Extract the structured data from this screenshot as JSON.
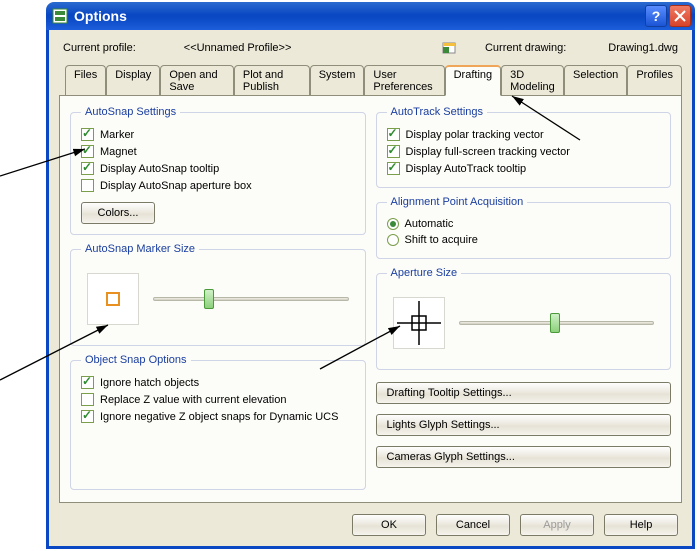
{
  "window": {
    "title": "Options"
  },
  "profile": {
    "label": "Current profile:",
    "value": "<<Unnamed Profile>>",
    "drawing_label": "Current drawing:",
    "drawing_value": "Drawing1.dwg"
  },
  "tabs": {
    "files": "Files",
    "display": "Display",
    "open_save": "Open and Save",
    "plot_publish": "Plot and Publish",
    "system": "System",
    "user_prefs": "User Preferences",
    "drafting": "Drafting",
    "modeling": "3D Modeling",
    "selection": "Selection",
    "profiles": "Profiles"
  },
  "groups": {
    "autosnap": {
      "legend": "AutoSnap Settings",
      "marker": "Marker",
      "magnet": "Magnet",
      "tooltip": "Display AutoSnap tooltip",
      "aperture": "Display AutoSnap aperture box",
      "colors_btn": "Colors..."
    },
    "autotrack": {
      "legend": "AutoTrack Settings",
      "polar": "Display polar tracking vector",
      "fullscreen": "Display full-screen tracking vector",
      "tooltip": "Display AutoTrack tooltip"
    },
    "alignment": {
      "legend": "Alignment Point Acquisition",
      "automatic": "Automatic",
      "shift": "Shift to acquire"
    },
    "marker_size": {
      "legend": "AutoSnap Marker Size"
    },
    "aperture_size": {
      "legend": "Aperture Size"
    },
    "osnap": {
      "legend": "Object Snap Options",
      "ignore_hatch": "Ignore hatch objects",
      "replace_z": "Replace Z value with current elevation",
      "ignore_neg_z": "Ignore negative Z object snaps for Dynamic UCS"
    },
    "drafting_tooltip_btn": "Drafting Tooltip Settings...",
    "lights_glyph_btn": "Lights Glyph Settings...",
    "cameras_glyph_btn": "Cameras Glyph Settings..."
  },
  "buttons": {
    "ok": "OK",
    "cancel": "Cancel",
    "apply": "Apply",
    "help": "Help"
  }
}
